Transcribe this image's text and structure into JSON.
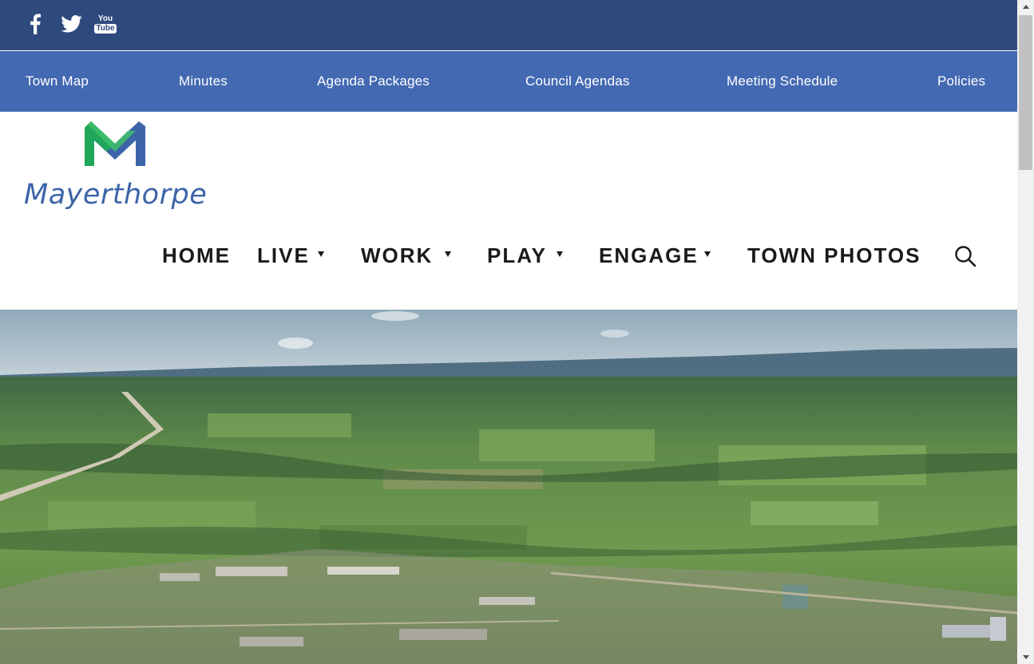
{
  "social": {
    "icons": [
      "facebook-icon",
      "twitter-icon",
      "youtube-icon"
    ],
    "youtube_you": "You",
    "youtube_tube": "Tube"
  },
  "quick_links": [
    {
      "label": "Town Map"
    },
    {
      "label": "Minutes"
    },
    {
      "label": "Agenda Packages"
    },
    {
      "label": "Council Agendas"
    },
    {
      "label": "Meeting Schedule"
    },
    {
      "label": "Policies"
    }
  ],
  "logo": {
    "text": "Mayerthorpe"
  },
  "main_nav": [
    {
      "label": "HOME",
      "has_dropdown": false
    },
    {
      "label": "LIVE",
      "has_dropdown": true
    },
    {
      "label": "WORK",
      "has_dropdown": true
    },
    {
      "label": "PLAY",
      "has_dropdown": true
    },
    {
      "label": "ENGAGE",
      "has_dropdown": true
    },
    {
      "label": "TOWN PHOTOS",
      "has_dropdown": false
    }
  ],
  "search": {
    "icon": "search-icon"
  },
  "hero": {
    "image": "aerial-town-landscape"
  },
  "colors": {
    "social_bar": "#2e4a7d",
    "quick_bar": "#4369b2",
    "logo_blue": "#3c64a8",
    "logo_green": "#1fa65a",
    "nav_text": "#1a1a1a"
  }
}
